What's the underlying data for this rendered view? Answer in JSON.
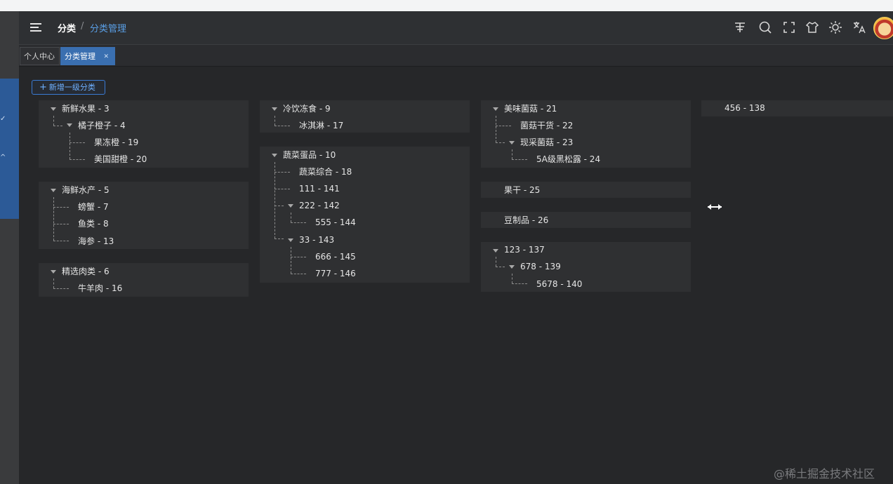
{
  "header": {
    "breadcrumb_root": "分类",
    "breadcrumb_sep": "/",
    "breadcrumb_current": "分类管理",
    "icons": [
      "git-icon",
      "search-icon",
      "fullscreen-icon",
      "theme-shirt-icon",
      "sun-icon",
      "translate-icon"
    ]
  },
  "tabs": [
    {
      "label": "个人中心",
      "active": false
    },
    {
      "label": "分类管理",
      "active": true
    }
  ],
  "toolbar": {
    "add_label": "新增一级分类"
  },
  "categories": {
    "c3": "新鲜水果 - 3",
    "c4": "橘子橙子 - 4",
    "c19": "果冻橙 - 19",
    "c20": "美国甜橙 - 20",
    "c5": "海鲜水产 - 5",
    "c7": "螃蟹 - 7",
    "c8": "鱼类 - 8",
    "c13": "海参 - 13",
    "c6": "精选肉类 - 6",
    "c16": "牛羊肉 - 16",
    "c9": "冷饮冻食 - 9",
    "c17": "冰淇淋 - 17",
    "c10": "蔬菜蛋品 - 10",
    "c18": "蔬菜综合 - 18",
    "c141": "111 - 141",
    "c142": "222 - 142",
    "c144": "555 - 144",
    "c143": "33 - 143",
    "c145": "666 - 145",
    "c146": "777 - 146",
    "c21": "美味菌菇 - 21",
    "c22": "菌菇干货 - 22",
    "c23": "现采菌菇 - 23",
    "c24": "5A级黑松露 - 24",
    "c25": "果干 - 25",
    "c26": "豆制品 - 26",
    "c137": "123 - 137",
    "c139": "678 - 139",
    "c140": "5678 - 140",
    "c138": "456 - 138"
  },
  "watermark": "@稀土掘金技术社区",
  "colors": {
    "accent": "#3a6fb0",
    "link": "#5a9fe6",
    "background": "#262729",
    "card": "#2f3032"
  }
}
